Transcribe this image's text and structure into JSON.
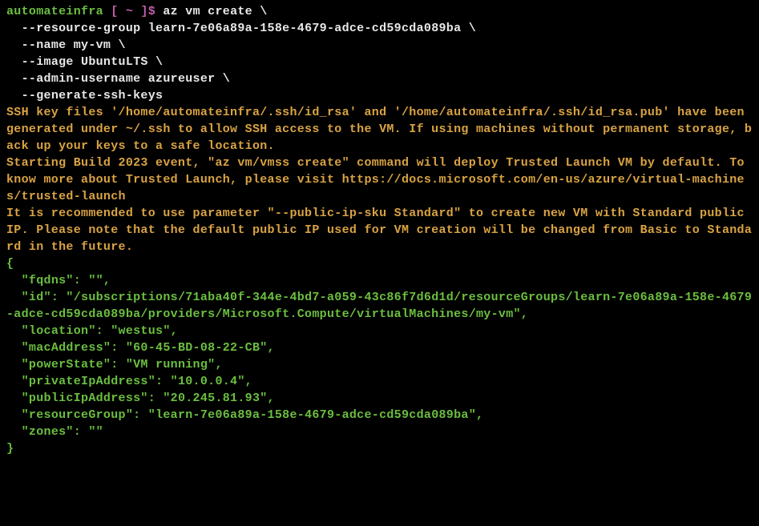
{
  "prompt": {
    "user": "automateinfra",
    "bracket_open": " [ ",
    "path": "~",
    "bracket_close": " ]",
    "symbol": "$ "
  },
  "command": {
    "line1": "az vm create \\",
    "line2": "  --resource-group learn-7e06a89a-158e-4679-adce-cd59cda089ba \\",
    "line3": "  --name my-vm \\",
    "line4": "  --image UbuntuLTS \\",
    "line5": "  --admin-username azureuser \\",
    "line6": "  --generate-ssh-keys"
  },
  "warnings": {
    "ssh_key": "SSH key files '/home/automateinfra/.ssh/id_rsa' and '/home/automateinfra/.ssh/id_rsa.pub' have been generated under ~/.ssh to allow SSH access to the VM. If using machines without permanent storage, back up your keys to a safe location.",
    "build_2023": "Starting Build 2023 event, \"az vm/vmss create\" command will deploy Trusted Launch VM by default. To know more about Trusted Launch, please visit https://docs.microsoft.com/en-us/azure/virtual-machines/trusted-launch",
    "public_ip": "It is recommended to use parameter \"--public-ip-sku Standard\" to create new VM with Standard public IP. Please note that the default public IP used for VM creation will be changed from Basic to Standard in the future."
  },
  "json_result": {
    "open_brace": "{",
    "fqdns": "  \"fqdns\": \"\",",
    "id": "  \"id\": \"/subscriptions/71aba40f-344e-4bd7-a059-43c86f7d6d1d/resourceGroups/learn-7e06a89a-158e-4679-adce-cd59cda089ba/providers/Microsoft.Compute/virtualMachines/my-vm\",",
    "location": "  \"location\": \"westus\",",
    "macAddress": "  \"macAddress\": \"60-45-BD-08-22-CB\",",
    "powerState": "  \"powerState\": \"VM running\",",
    "privateIpAddress": "  \"privateIpAddress\": \"10.0.0.4\",",
    "publicIpAddress": "  \"publicIpAddress\": \"20.245.81.93\",",
    "resourceGroup": "  \"resourceGroup\": \"learn-7e06a89a-158e-4679-adce-cd59cda089ba\",",
    "zones": "  \"zones\": \"\"",
    "close_brace": "}"
  }
}
